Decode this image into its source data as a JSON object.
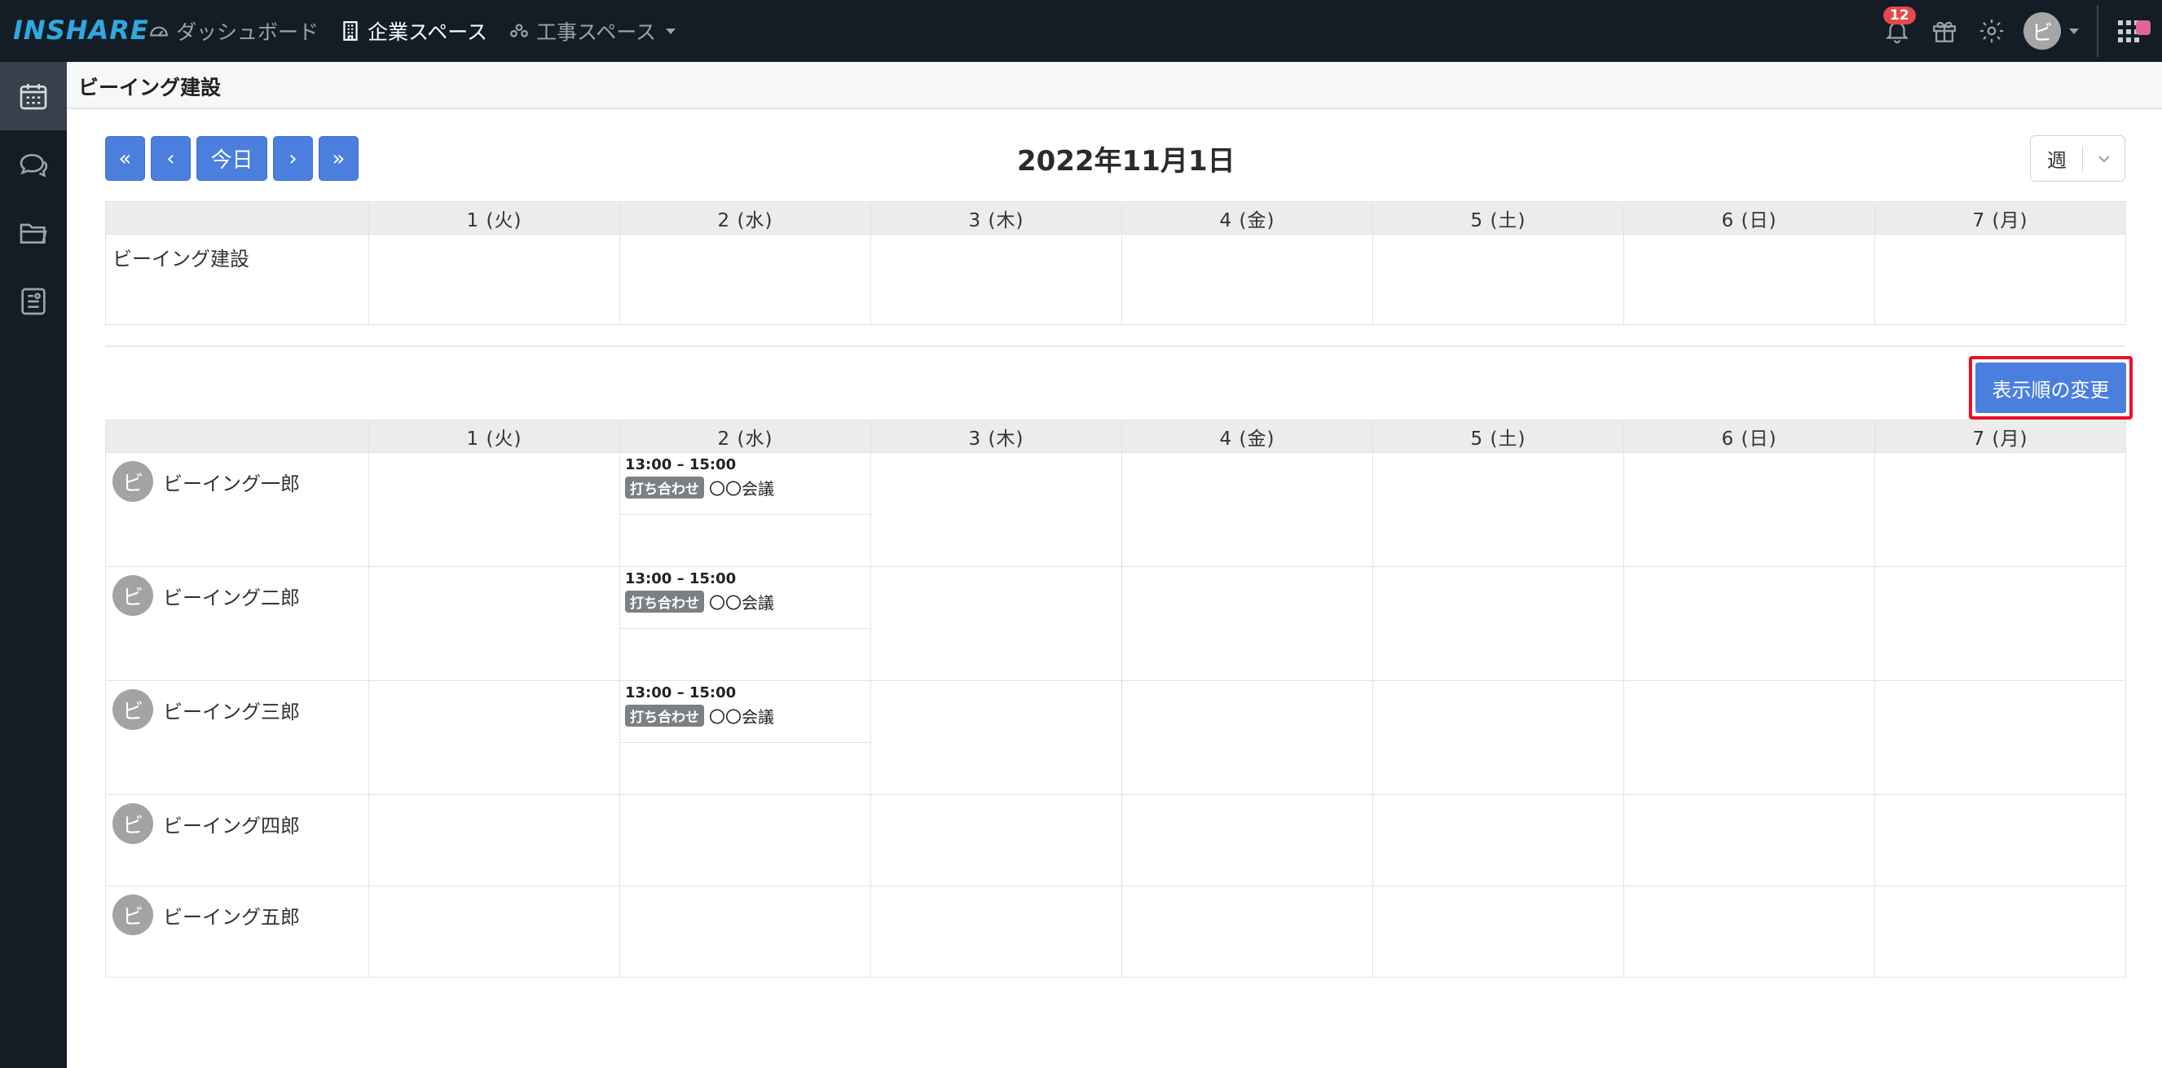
{
  "app": {
    "logo": "INSHARE",
    "nav": [
      {
        "label": "ダッシュボード",
        "icon": "dashboard-icon"
      },
      {
        "label": "企業スペース",
        "icon": "building-icon"
      },
      {
        "label": "工事スペース",
        "icon": "users-icon"
      }
    ],
    "notification_count": "12",
    "user_initial": "ビ"
  },
  "sidebar": {
    "items": [
      {
        "icon": "calendar-icon",
        "active": true
      },
      {
        "icon": "chat-icon",
        "active": false
      },
      {
        "icon": "folder-icon",
        "active": false
      },
      {
        "icon": "document-icon",
        "active": false
      }
    ]
  },
  "page": {
    "title": "ビーイング建設"
  },
  "calendar": {
    "nav_buttons": {
      "first": "«",
      "prev": "‹",
      "today": "今日",
      "next": "›",
      "last": "»"
    },
    "current_date": "2022年11月1日",
    "view": "週",
    "days": [
      {
        "label": "1 (火)",
        "type": "normal"
      },
      {
        "label": "2 (水)",
        "type": "normal"
      },
      {
        "label": "3 (木)",
        "type": "holiday"
      },
      {
        "label": "4 (金)",
        "type": "normal"
      },
      {
        "label": "5 (土)",
        "type": "saturday"
      },
      {
        "label": "6 (日)",
        "type": "holiday"
      },
      {
        "label": "7 (月)",
        "type": "normal"
      }
    ],
    "company_row": "ビーイング建設",
    "order_button": "表示順の変更",
    "people": [
      {
        "initial": "ビ",
        "name": "ビーイング一郎",
        "event": {
          "time": "13:00 – 15:00",
          "tag": "打ち合わせ",
          "title": "〇〇会議"
        }
      },
      {
        "initial": "ビ",
        "name": "ビーイング二郎",
        "event": {
          "time": "13:00 – 15:00",
          "tag": "打ち合わせ",
          "title": "〇〇会議"
        }
      },
      {
        "initial": "ビ",
        "name": "ビーイング三郎",
        "event": {
          "time": "13:00 – 15:00",
          "tag": "打ち合わせ",
          "title": "〇〇会議"
        }
      },
      {
        "initial": "ビ",
        "name": "ビーイング四郎"
      },
      {
        "initial": "ビ",
        "name": "ビーイング五郎"
      }
    ]
  },
  "colors": {
    "navbar": "#141d26",
    "primary": "#4a7fde",
    "holiday": "#fbcfd0",
    "saturday": "#b4cdf8",
    "highlight": "#e8102a"
  }
}
